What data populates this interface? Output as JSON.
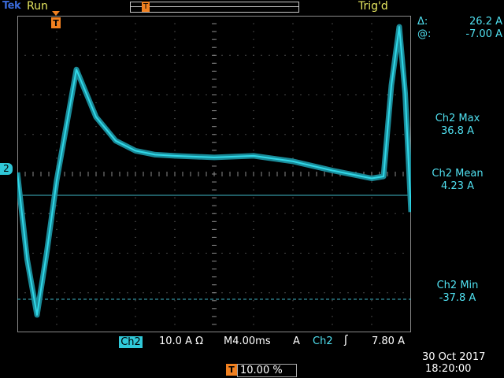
{
  "header": {
    "brand": "Tek",
    "run_status": "Run",
    "trig_status": "Trig'd"
  },
  "cursor_readout": {
    "delta_symbol": "Δ:",
    "delta_value": "26.2 A",
    "at_symbol": "@:",
    "at_value": "-7.00 A"
  },
  "measurements": {
    "max_label": "Ch2 Max",
    "max_value": "36.8 A",
    "mean_label": "Ch2 Mean",
    "mean_value": "4.23 A",
    "min_label": "Ch2 Min",
    "min_value": "-37.8 A"
  },
  "bottom": {
    "channel": "Ch2",
    "volts_div": "10.0 A Ω",
    "timebase": "M4.00ms",
    "trig_coupling": "A",
    "trig_source": "Ch2",
    "trig_slope": "ʃ",
    "trig_level": "7.80 A",
    "date": "30 Oct  2017",
    "time": "18:20:00",
    "trig_position": "10.00 %",
    "trig_badge": "T"
  },
  "channel_marker": "2",
  "colors": {
    "trace": "#30d8e8",
    "grid": "#8a8a8a",
    "accent": "#f08020"
  },
  "chart_data": {
    "type": "line",
    "series": [
      {
        "x": [
          0,
          0.25,
          0.5,
          0.75,
          1.0,
          1.25,
          1.5,
          1.75,
          2.0,
          2.25,
          2.5,
          3.0,
          3.5,
          4.0,
          5.0,
          6.0,
          7.0,
          8.0,
          9.0,
          9.3,
          9.5,
          9.7,
          9.85,
          10.0
        ],
        "y": [
          0,
          -22,
          -36,
          -20,
          -2,
          12,
          26,
          20,
          14,
          11,
          8,
          5.5,
          4.5,
          4.2,
          3.8,
          4.2,
          2.8,
          0.5,
          -1.5,
          -1,
          22,
          36.8,
          20,
          -10
        ]
      }
    ],
    "xlim": [
      0,
      10
    ],
    "ylim": [
      -40,
      40
    ],
    "grid": true
  }
}
